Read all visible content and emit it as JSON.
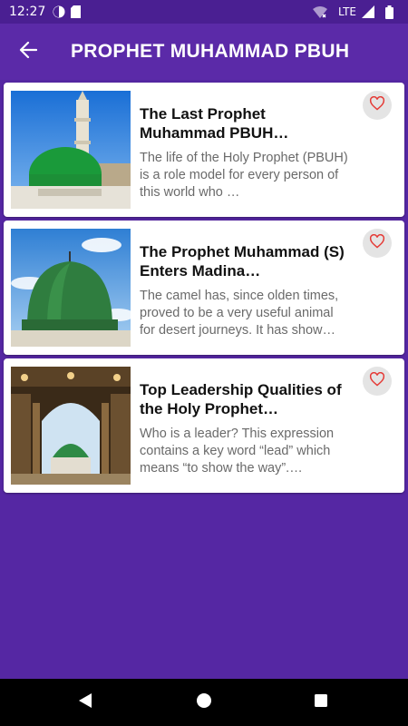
{
  "status_bar": {
    "time": "12:27",
    "network": "LTE",
    "icons": [
      "circle-app-icon",
      "sd-card-icon",
      "wifi-icon",
      "signal-icon",
      "battery-icon"
    ]
  },
  "app_bar": {
    "title": "PROPHET MUHAMMAD PBUH",
    "back_icon": "arrow-left-icon"
  },
  "colors": {
    "primary": "#5b2aa8",
    "background": "#5527a3",
    "status_bar": "#4a1f92",
    "heart": "#e53935"
  },
  "articles": [
    {
      "title": "The Last Prophet Muhammad PBUH…",
      "description": "The life of the Holy Prophet (PBUH) is a role model for every person of this world who …",
      "favorite_icon": "heart-outline-icon"
    },
    {
      "title": "The Prophet Muhammad (S) Enters Madina…",
      "description": "The camel has, since olden times, proved to be a very useful animal for desert journeys. It has show…",
      "favorite_icon": "heart-outline-icon"
    },
    {
      "title": "Top Leadership Qualities of the Holy Prophet Muhamm…",
      "description": "Who is a leader? This expression contains a key word “lead” which means “to show the way”.…",
      "favorite_icon": "heart-outline-icon"
    }
  ],
  "nav_bar": {
    "icons": [
      "back-triangle-icon",
      "home-circle-icon",
      "recents-square-icon"
    ]
  }
}
